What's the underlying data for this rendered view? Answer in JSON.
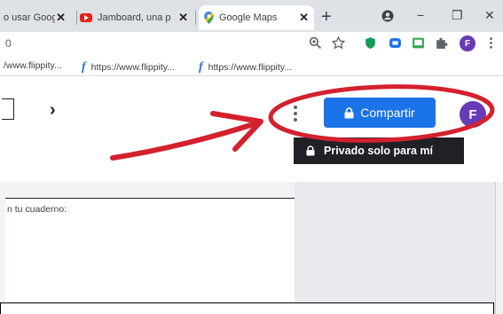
{
  "tabs": [
    {
      "label": "o usar Goog",
      "close": "✕"
    },
    {
      "label": "Jamboard, una p",
      "close": "✕"
    },
    {
      "label": "Google Maps",
      "close": "✕"
    }
  ],
  "new_tab": "+",
  "window_controls": {
    "minimize": "−",
    "maximize": "❐",
    "close": "✕"
  },
  "address_bar": {
    "value": "0"
  },
  "profile_initial_small": "F",
  "bookmarks": [
    {
      "label": "/www.flippity..."
    },
    {
      "label": "https://www.flippity..."
    },
    {
      "label": "https://www.flippity..."
    }
  ],
  "bookmark_icon": "f",
  "app": {
    "share_label": "Compartir",
    "avatar_initial": "F",
    "tooltip": "Privado solo para mí",
    "next_symbol": "›"
  },
  "content": {
    "card_text": "n tu cuaderno:"
  },
  "colors": {
    "accent": "#1a73e8",
    "avatar": "#673ab7",
    "annotation": "#d3212d",
    "tooltip_bg": "#202124"
  },
  "icons": [
    "youtube-icon",
    "maps-pin-icon",
    "zoom-icon",
    "star-icon",
    "shield-extension-icon",
    "extension-icon",
    "puzzle-icon",
    "lock-icon",
    "kebab-menu-icon",
    "chevron-right-icon"
  ]
}
